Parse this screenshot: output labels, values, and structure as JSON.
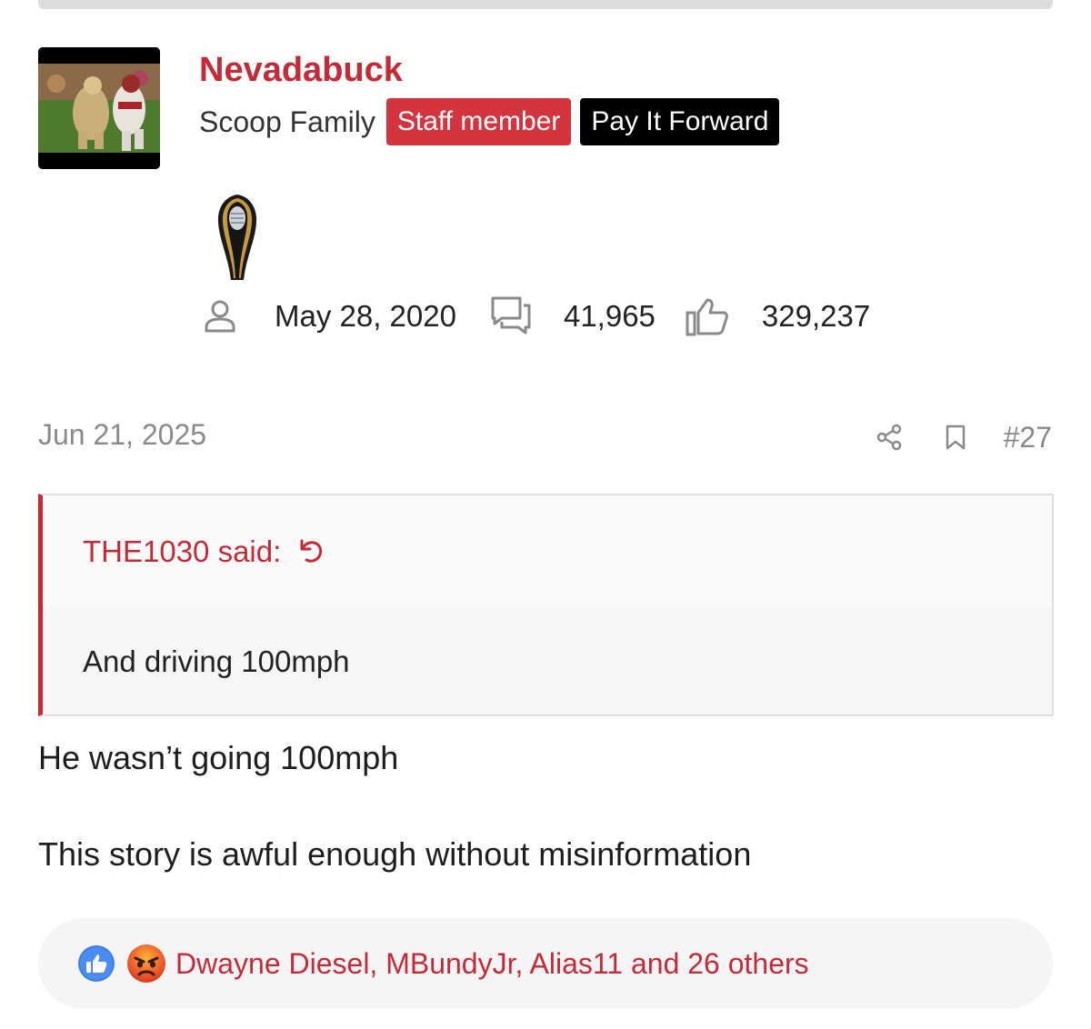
{
  "author": {
    "username": "Nevadabuck",
    "user_title": "Scoop Family",
    "banners": [
      "Staff member",
      "Pay It Forward"
    ],
    "joined": "May 28, 2020",
    "messages": "41,965",
    "reactions": "329,237",
    "trophy_icon": "cfp-trophy-icon"
  },
  "post": {
    "date": "Jun 21, 2025",
    "number": "#27",
    "quote": {
      "attribution": "THE1030 said:",
      "text": "And driving 100mph"
    },
    "paragraphs": [
      "He wasn’t going 100mph",
      "This story is awful enough without misinformation"
    ],
    "reaction_summary": "Dwayne Diesel, MBundyJr, Alias11 and 26 others",
    "reaction_types": [
      "like-reaction-icon",
      "angry-reaction-icon"
    ]
  },
  "colors": {
    "brand_red": "#c72a37",
    "staff_badge": "#d4343d",
    "pif_badge": "#000000",
    "muted_text": "#8a8a8a"
  }
}
